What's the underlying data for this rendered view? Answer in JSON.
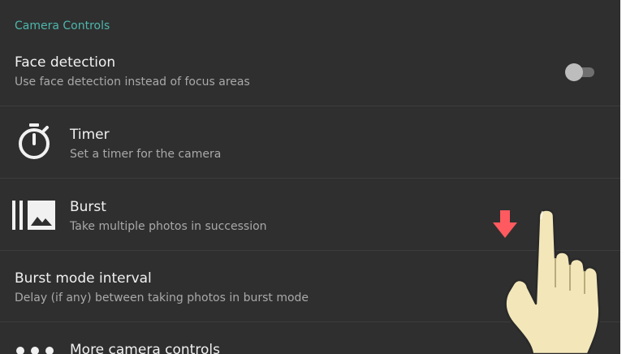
{
  "section": {
    "header": "Camera Controls"
  },
  "items": [
    {
      "title": "Face detection",
      "summary": "Use face detection instead of focus areas",
      "toggle_on": false
    },
    {
      "title": "Timer",
      "summary": "Set a timer for the camera",
      "icon": "timer-icon"
    },
    {
      "title": "Burst",
      "summary": "Take multiple photos in succession",
      "icon": "burst-icon"
    },
    {
      "title": "Burst mode interval",
      "summary": "Delay (if any) between taking photos in burst mode"
    },
    {
      "title": "More camera controls",
      "icon": "more-dots-icon"
    }
  ],
  "overlay": {
    "gesture": "swipe-down",
    "arrow_color": "#ff5a5f",
    "hand_color": "#f3e7ba",
    "hand_icon": "pointing-hand-icon"
  },
  "colors": {
    "background": "#2f2f2f",
    "accent": "#4db6ac",
    "primary_text": "#f1f1f1",
    "secondary_text": "#a9a9a9"
  }
}
